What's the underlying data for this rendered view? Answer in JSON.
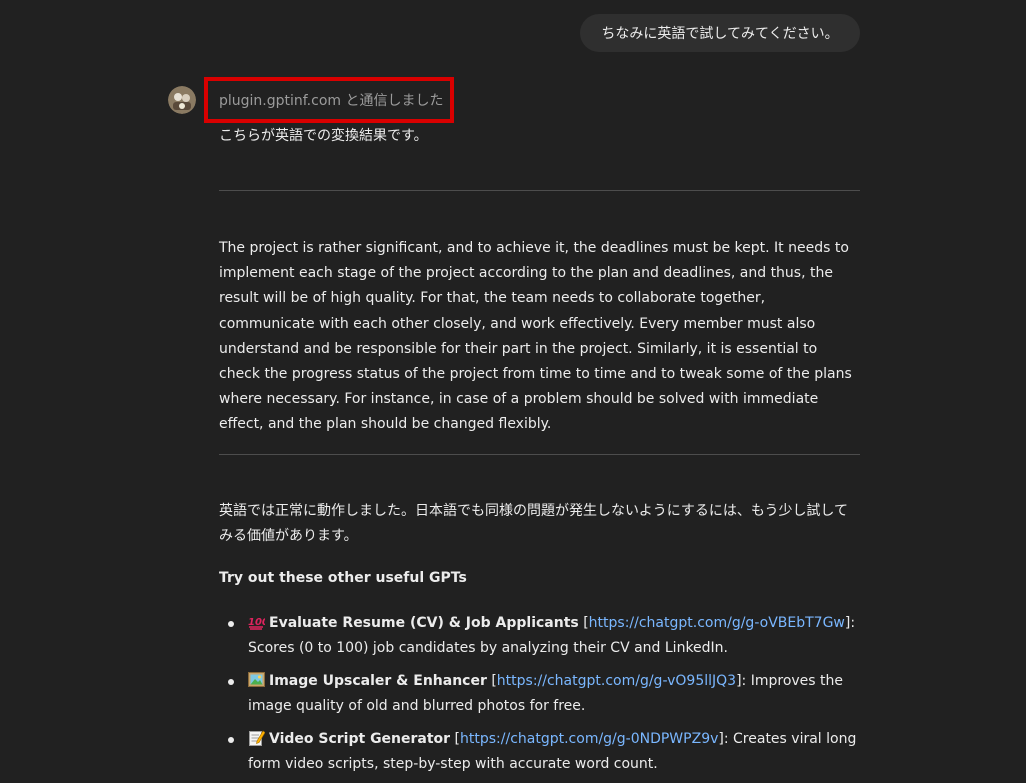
{
  "user_message": "ちなみに英語で試してみてください。",
  "assistant": {
    "avatar_icon": "avatar-icon",
    "plugin_status": "plugin.gptinf.com と通信しました",
    "intro": "こちらが英語での変換結果です。",
    "converted_text": "The project is rather significant, and to achieve it, the deadlines must be kept. It needs to implement each stage of the project according to the plan and deadlines, and thus, the result will be of high quality. For that, the team needs to collaborate together, communicate with each other closely, and work effectively. Every member must also understand and be responsible for their part in the project. Similarly, it is essential to check the progress status of the project from time to time and to tweak some of the plans where necessary. For instance, in case of a problem should be solved with immediate effect, and the plan should be changed flexibly.",
    "followup": "英語では正常に動作しました。日本語でも同様の問題が発生しないようにするには、もう少し試してみる価値があります。",
    "gpts_heading": "Try out these other useful GPTs",
    "gpts": [
      {
        "icon": "hundred-points-icon",
        "name": "Evaluate Resume (CV) & Job Applicants",
        "link_open": " [",
        "url": "https://chatgpt.com/g/g-oVBEbT7Gw",
        "link_close": "]",
        "description": ": Scores (0 to 100) job candidates by analyzing their CV and LinkedIn."
      },
      {
        "icon": "framed-picture-icon",
        "name": "Image Upscaler & Enhancer",
        "link_open": " [",
        "url": "https://chatgpt.com/g/g-vO95llJQ3",
        "link_close": "]",
        "description": ": Improves the image quality of old and blurred photos for free."
      },
      {
        "icon": "memo-icon",
        "name": "Video Script Generator",
        "link_open": " [",
        "url": "https://chatgpt.com/g/g-0NDPWPZ9v",
        "link_close": "]",
        "description": ": Creates viral long form video scripts, step-by-step with accurate word count."
      }
    ]
  },
  "colors": {
    "background": "#212121",
    "user_bubble": "#2f2f2f",
    "highlight_border": "#d90000",
    "link": "#7ab7ff"
  }
}
